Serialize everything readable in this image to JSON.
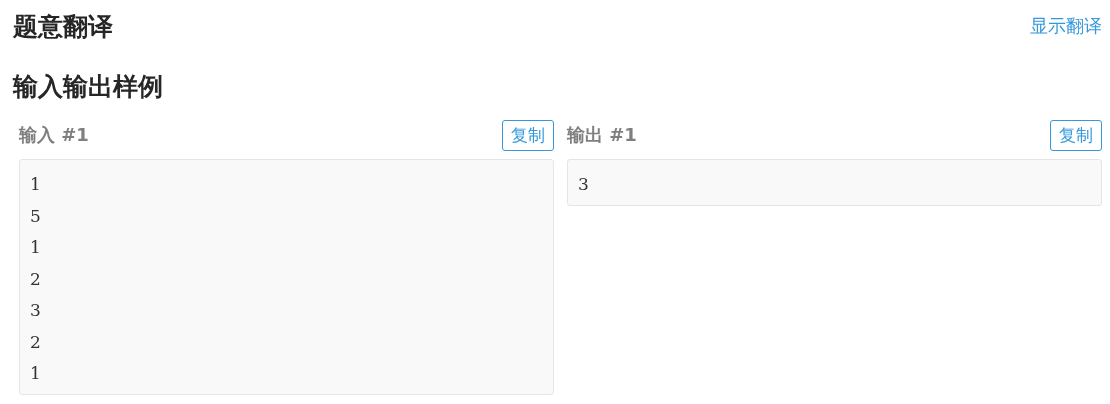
{
  "translation_section": {
    "title": "题意翻译",
    "toggle_link": "显示翻译"
  },
  "samples_section": {
    "title": "输入输出样例",
    "samples": [
      {
        "label": "输入 #1",
        "copy_button": "复制",
        "lines": [
          "1",
          "5",
          "1",
          "2",
          "3",
          "2",
          "1"
        ]
      },
      {
        "label": "输出 #1",
        "copy_button": "复制",
        "lines": [
          "3"
        ]
      }
    ]
  }
}
